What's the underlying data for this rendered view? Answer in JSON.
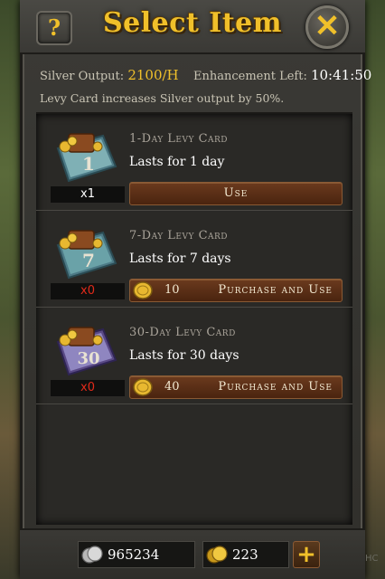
{
  "header": {
    "title": "Select Item",
    "help_label": "?",
    "close_label": "✕"
  },
  "info": {
    "silver_output_label": "Silver Output:",
    "silver_output_value": "2100/H",
    "enhancement_label": "Enhancement Left:",
    "enhancement_value": "10:41:50",
    "description": "Levy Card increases Silver output by 50%."
  },
  "items": [
    {
      "name": "1-Day Levy Card",
      "desc": "Lasts for 1 day",
      "count": "x1",
      "action": "Use",
      "card_number": "1"
    },
    {
      "name": "7-Day Levy Card",
      "desc": "Lasts for 7 days",
      "count": "x0",
      "price": "10",
      "action": "Purchase and Use",
      "card_number": "7"
    },
    {
      "name": "30-Day Levy Card",
      "desc": "Lasts for 30 days",
      "count": "x0",
      "price": "40",
      "action": "Purchase and Use",
      "card_number": "30"
    }
  ],
  "footer": {
    "silver_amount": "965234",
    "gold_amount": "223",
    "plus_label": "+",
    "corner_tag": "HC"
  },
  "colors": {
    "gold_text": "#f0c02a",
    "count_zero": "#e12a1a",
    "button_brown": "#5a2e16"
  }
}
